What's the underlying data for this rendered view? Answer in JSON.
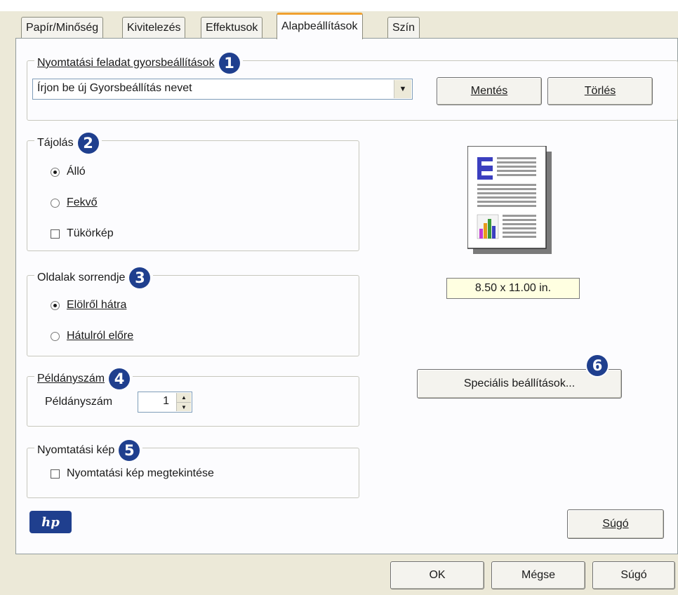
{
  "tabs": [
    "Papír/Minőség",
    "Kivitelezés",
    "Effektusok",
    "Alapbeállítások",
    "Szín"
  ],
  "active_tab": 3,
  "quicksets": {
    "legend": "Nyomtatási feladat gyorsbeállítások",
    "badge": "1",
    "combo_value": "Írjon be új Gyorsbeállítás nevet",
    "save_label": "Mentés",
    "delete_label": "Törlés"
  },
  "orientation": {
    "legend": "Tájolás",
    "badge": "2",
    "portrait": "Álló",
    "landscape": "Fekvő",
    "mirror": "Tükörkép",
    "selected": "portrait",
    "mirror_checked": false
  },
  "page_order": {
    "legend": "Oldalak sorrendje",
    "badge": "3",
    "front_to_back": "Elölről hátra",
    "back_to_front": "Hátulról előre",
    "selected": "front_to_back"
  },
  "copies": {
    "legend": "Példányszám",
    "badge": "4",
    "label": "Példányszám",
    "value": "1"
  },
  "print_preview": {
    "legend": "Nyomtatási kép",
    "badge": "5",
    "checkbox_label": "Nyomtatási kép megtekintése",
    "checked": false
  },
  "preview": {
    "paper_size": "8.50 x 11.00 in."
  },
  "advanced": {
    "label": "Speciális beállítások...",
    "badge": "6"
  },
  "logo": {
    "text": "hp"
  },
  "panel_help_label": "Súgó",
  "footer": {
    "ok_label": "OK",
    "cancel_label": "Mégse",
    "help_label": "Súgó"
  },
  "colors": {
    "badge": "#1f3f8e",
    "tab_highlight": "#f0a030",
    "tooltip_bg": "#ffffe1",
    "dialog_bg": "#ece9d8"
  }
}
